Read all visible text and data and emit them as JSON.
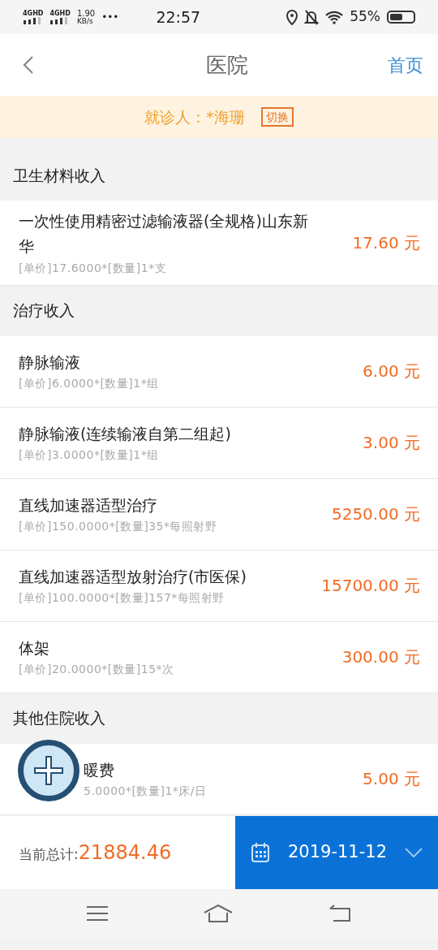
{
  "status_bar": {
    "network_1": "4GHD",
    "network_2": "4GHD",
    "speed": "1.90",
    "speed_unit": "KB/s",
    "more": "•••",
    "time": "22:57",
    "battery": "55%"
  },
  "header": {
    "title": "医院",
    "home_link": "首页"
  },
  "patient": {
    "label": "就诊人：*海珊",
    "switch_button": "切换"
  },
  "sections": [
    {
      "title": "卫生材料收入",
      "items": [
        {
          "name": "一次性使用精密过滤输液器(全规格)山东新华",
          "detail": "[单价]17.6000*[数量]1*支",
          "amount": "17.60 元"
        }
      ]
    },
    {
      "title": "治疗收入",
      "items": [
        {
          "name": "静脉输液",
          "detail": "[单价]6.0000*[数量]1*组",
          "amount": "6.00 元"
        },
        {
          "name": "静脉输液(连续输液自第二组起)",
          "detail": "[单价]3.0000*[数量]1*组",
          "amount": "3.00 元"
        },
        {
          "name": "直线加速器适型治疗",
          "detail": "[单价]150.0000*[数量]35*每照射野",
          "amount": "5250.00 元"
        },
        {
          "name": "直线加速器适型放射治疗(市医保)",
          "detail": "[单价]100.0000*[数量]157*每照射野",
          "amount": "15700.00 元"
        },
        {
          "name": "体架",
          "detail": "[单价]20.0000*[数量]15*次",
          "amount": "300.00 元"
        }
      ]
    },
    {
      "title": "其他住院收入",
      "items": [
        {
          "name": "暖费",
          "detail": "5.0000*[数量]1*床/日",
          "amount": "5.00 元",
          "covered": true
        }
      ]
    }
  ],
  "footer": {
    "total_label": "当前总计:",
    "total": "21884.46",
    "date": "2019-11-12"
  }
}
